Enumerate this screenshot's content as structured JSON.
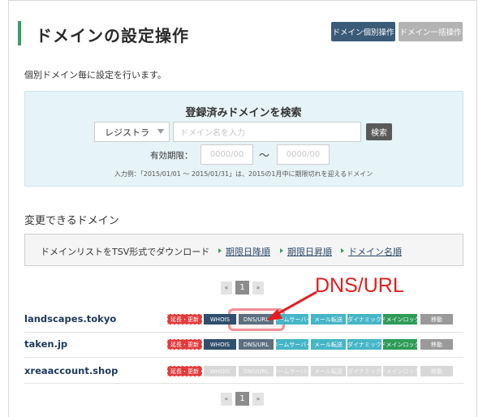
{
  "page": {
    "title": "ドメインの設定操作",
    "description": "個別ドメイン毎に設定を行います。"
  },
  "header_buttons": {
    "individual": "ドメイン個別操作",
    "bulk": "ドメイン一括操作"
  },
  "search": {
    "title": "登録済みドメインを検索",
    "select_value": "レジストラ",
    "domain_placeholder": "ドメイン名を入力",
    "button": "検索",
    "expiry_label": "有効期限：",
    "date_from_placeholder": "0000/00",
    "date_to_placeholder": "0000/00",
    "tilde": "〜",
    "example": "入力例：「2015/01/01 〜 2015/01/31」は、2015の1月中に期限切れを迎えるドメイン"
  },
  "domains_section": {
    "title": "変更できるドメイン",
    "download_text": "ドメインリストをTSV形式でダウンロード",
    "links": [
      "期限日降順",
      "期限日昇順",
      "ドメイン名順"
    ]
  },
  "pagination": {
    "prev": "«",
    "page": "1",
    "next": "»"
  },
  "domains": [
    {
      "name": "landscapes.tokyo",
      "tags": [
        "延長・更新",
        "WHOIS",
        "DNS/URL",
        "ネームサーバー",
        "メール転送",
        "ダイナミック",
        "ドメインロック",
        "移動"
      ]
    },
    {
      "name": "taken.jp",
      "tags": [
        "延長・更新",
        "WHOIS",
        "DNS/URL",
        "ネームサーバー",
        "メール転送",
        "ダイナミック",
        "ドメインロック",
        "移動"
      ]
    },
    {
      "name": "xreaaccount.shop",
      "tags": [
        "延長・更新",
        "WHOIS",
        "DNS/URL",
        "ネームサーバー",
        "メール転送",
        "ダイナミック",
        "ドメインロック",
        "移動"
      ]
    }
  ],
  "annotation": {
    "callout": "DNS/URL"
  },
  "colors": {
    "accent_green": "#3a9d5d",
    "navy_button": "#3a5a78",
    "renew_red": "#e23b3b",
    "callout_red": "#e31e1e"
  }
}
